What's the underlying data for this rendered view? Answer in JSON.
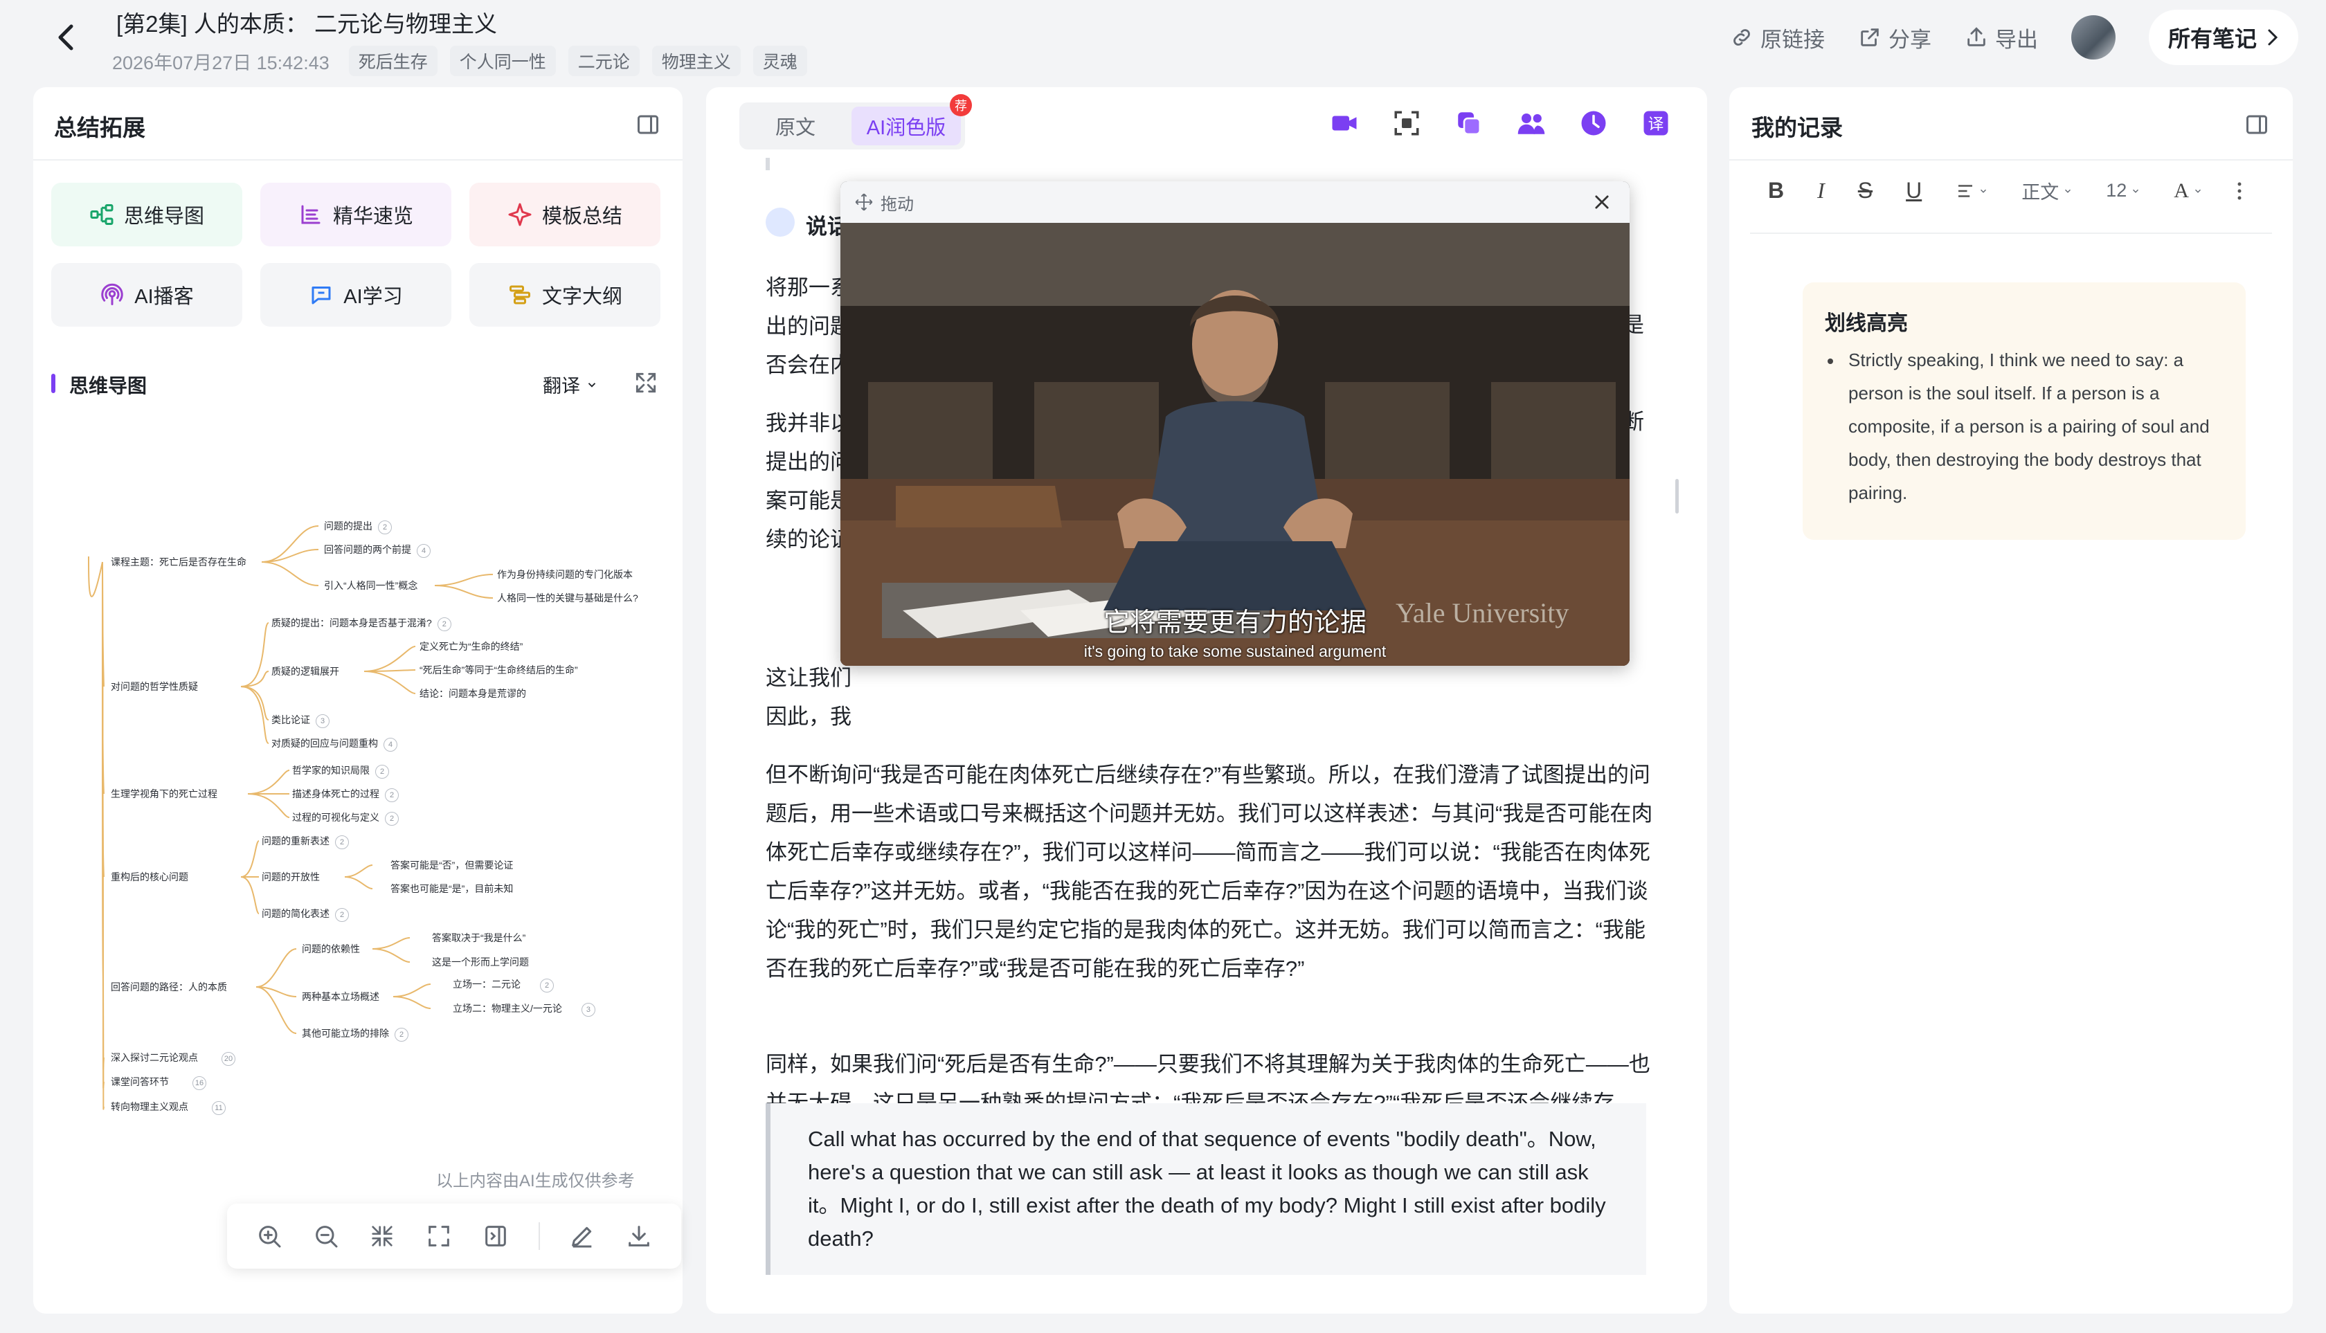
{
  "header": {
    "title": "[第2集] 人的本质： 二元论与物理主义",
    "date": "2026年07月27日 15:42:43",
    "tags": [
      "死后生存",
      "个人同一性",
      "二元论",
      "物理主义",
      "灵魂"
    ],
    "actions": {
      "source_link": "原链接",
      "share": "分享",
      "export": "导出"
    },
    "all_notes": "所有笔记"
  },
  "left": {
    "title": "总结拓展",
    "tools": [
      "思维导图",
      "精华速览",
      "模板总结",
      "AI播客",
      "AI学习",
      "文字大纲"
    ],
    "section_title": "思维导图",
    "translate": "翻译",
    "mindmap": {
      "root_branches": [
        {
          "label": "课程主题：死亡后是否存在生命",
          "children": [
            {
              "label": "问题的提出",
              "badge": "2"
            },
            {
              "label": "回答问题的两个前提",
              "badge": "4"
            },
            {
              "label": "引入“人格同一性”概念",
              "children": [
                "作为身份持续问题的专门化版本",
                "人格同一性的关键与基础是什么?"
              ]
            }
          ]
        },
        {
          "label": "对问题的哲学性质疑",
          "children": [
            {
              "label": "质疑的提出：问题本身是否基于混淆?",
              "badge": "2"
            },
            {
              "label": "质疑的逻辑展开",
              "children": [
                "定义死亡为“生命的终结”",
                "“死后生命”等同于“生命终结后的生命”",
                "结论：问题本身是荒谬的"
              ]
            },
            {
              "label": "类比论证",
              "badge": "3"
            },
            {
              "label": "对质疑的回应与问题重构",
              "badge": "4"
            }
          ]
        },
        {
          "label": "生理学视角下的死亡过程",
          "children": [
            {
              "label": "哲学家的知识局限",
              "badge": "2"
            },
            {
              "label": "描述身体死亡的过程",
              "badge": "2"
            },
            {
              "label": "过程的可视化与定义",
              "badge": "2"
            }
          ]
        },
        {
          "label": "重构后的核心问题",
          "children": [
            {
              "label": "问题的重新表述",
              "badge": "2"
            },
            {
              "label": "问题的开放性",
              "children": [
                "答案可能是“否”，但需要论证",
                "答案也可能是“是”，目前未知"
              ]
            },
            {
              "label": "问题的简化表述",
              "badge": "2"
            }
          ]
        },
        {
          "label": "回答问题的路径：人的本质",
          "children": [
            {
              "label": "问题的依赖性",
              "children": [
                "答案取决于“我是什么”",
                "这是一个形而上学问题"
              ]
            },
            {
              "label": "两种基本立场概述",
              "children": [
                "立场一：二元论",
                "立场二：物理主义/一元论"
              ],
              "child_badges": [
                "2",
                "3"
              ]
            },
            {
              "label": "其他可能立场的排除",
              "badge": "2"
            }
          ]
        },
        {
          "label": "深入探讨二元论观点",
          "badge": "20"
        },
        {
          "label": "课堂问答环节",
          "badge": "16"
        },
        {
          "label": "转向物理主义观点",
          "badge": "11"
        }
      ]
    },
    "disclaimer": "以上内容由AI生成仅供参考"
  },
  "middle": {
    "tabs": [
      "原文",
      "AI润色版"
    ],
    "active_tab": "AI润色版",
    "badge": "荐",
    "speaker_label": "说话",
    "video": {
      "drag_label": "拖动",
      "subtitle_zh": "它将需要更有力的论据",
      "subtitle_en": "it's going to take some sustained argument",
      "watermark": "Yale University"
    },
    "paragraphs_partial": [
      [
        "将那一系",
        "出的问题",
        "否会在内"
      ],
      [
        "我并非以",
        "提出的问",
        "案可能是",
        "续的论证"
      ],
      [
        "这让我们",
        "因此，我"
      ]
    ],
    "partial_right": [
      "是",
      "断"
    ],
    "paragraphs": [
      "但不断询问“我是否可能在肉体死亡后继续存在?”有些繁琐。所以，在我们澄清了试图提出的问题后，用一些术语或口号来概括这个问题并无妨。我们可以这样表述：与其问“我是否可能在肉体死亡后幸存或继续存在?”，我们可以这样问——简而言之——我们可以说：“我能否在肉体死亡后幸存?”这并无妨。或者，“我能否在我的死亡后幸存?”因为在这个问题的语境中，当我们谈论“我的死亡”时，我们只是约定它指的是我肉体的死亡。这并无妨。我们可以简而言之：“我能否在我的死亡后幸存?”或“我是否可能在我的死亡后幸存?”",
      "同样，如果我们问“死后是否有生命?”——只要我们不将其理解为关于我肉体的生命死亡——也并无大碍。这只是另一种熟悉的提问方式：“我死后是否还会存在?”“我死后是否还会继续存在?”因此，我认为这是一个完全合理的问题。"
    ],
    "quote": "Call what has occurred by the end of that sequence of events \"bodily death\"。Now, here's a question that we can still ask — at least it looks as though we can still ask it。Might I, or do I, still exist after the death of my body?  Might I still exist after bodily death?"
  },
  "right": {
    "title": "我的记录",
    "toolbar": {
      "paragraph": "正文",
      "font_size": "12"
    },
    "highlight_title": "划线高亮",
    "highlight_item": "Strictly speaking, I think we need to say: a person is the soul itself. If a person is a composite, if a person is a pairing of soul and body, then destroying the body destroys that pairing."
  },
  "colors": {
    "accent": "#7b3ff2",
    "mindmap_line": "#e8b86b",
    "badge_red": "#f23b3b"
  }
}
